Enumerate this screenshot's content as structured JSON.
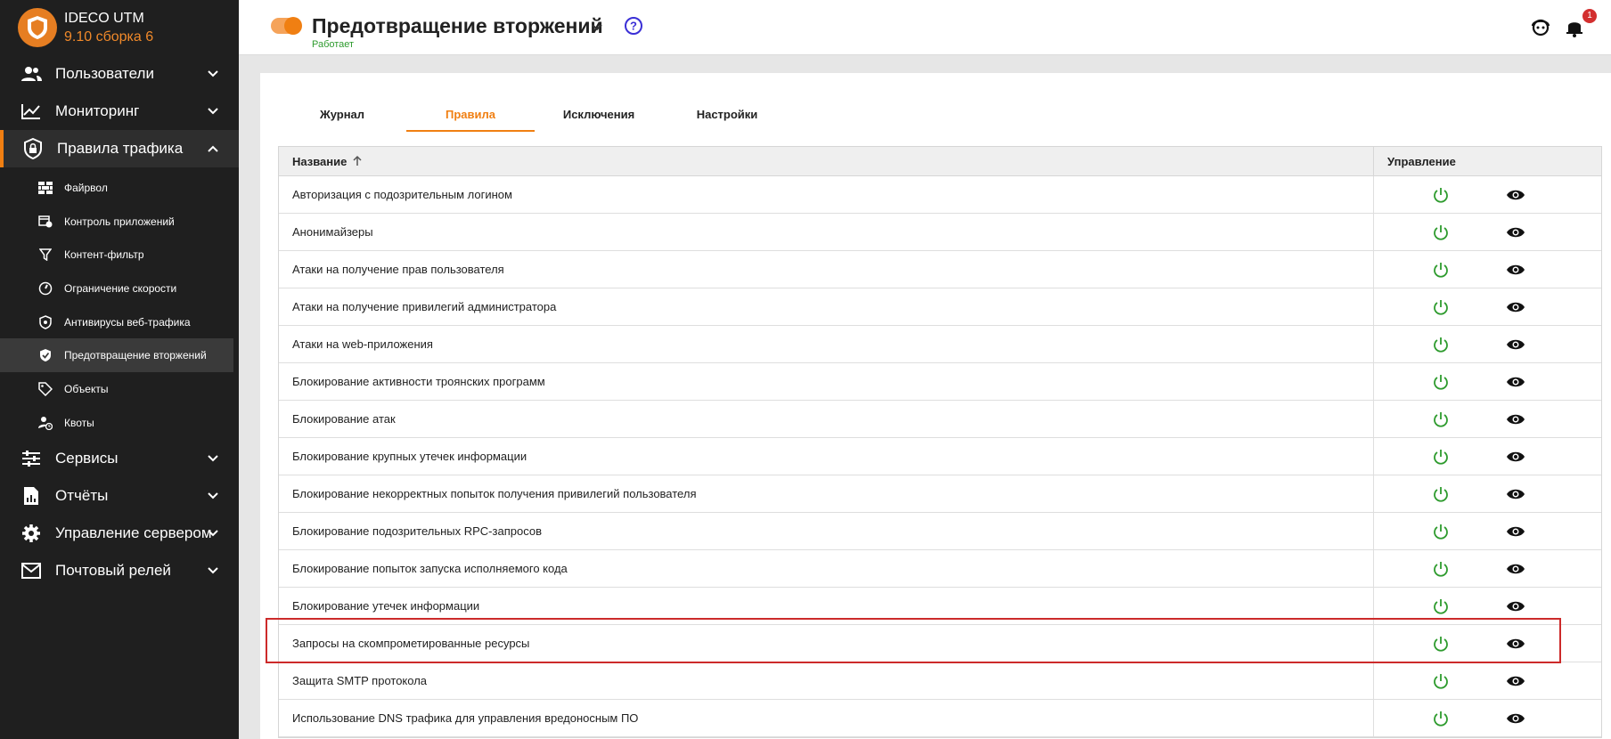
{
  "brand": {
    "name": "IDECO UTM",
    "version": "9.10 сборка 6"
  },
  "sidebar": {
    "top_items": [
      {
        "label": "Пользователи",
        "icon": "users-icon"
      },
      {
        "label": "Мониторинг",
        "icon": "chart-line-icon"
      }
    ],
    "active_item": {
      "label": "Правила трафика",
      "icon": "shield-lock-icon"
    },
    "sub_items": [
      {
        "label": "Файрвол",
        "icon": "brick-wall-icon"
      },
      {
        "label": "Контроль приложений",
        "icon": "app-control-icon"
      },
      {
        "label": "Контент-фильтр",
        "icon": "filter-icon"
      },
      {
        "label": "Ограничение скорости",
        "icon": "speedometer-icon"
      },
      {
        "label": "Антивирусы веб-трафика",
        "icon": "shield-icon"
      },
      {
        "label": "Предотвращение вторжений",
        "icon": "shield-check-icon"
      },
      {
        "label": "Объекты",
        "icon": "tag-icon"
      },
      {
        "label": "Квоты",
        "icon": "user-clock-icon"
      }
    ],
    "bottom_items": [
      {
        "label": "Сервисы",
        "icon": "sliders-icon"
      },
      {
        "label": "Отчёты",
        "icon": "report-icon"
      },
      {
        "label": "Управление сервером",
        "icon": "gear-icon"
      },
      {
        "label": "Почтовый релей",
        "icon": "mail-icon"
      }
    ]
  },
  "header": {
    "title": "Предотвращение вторжений",
    "status": "Работает",
    "notifications_count": "1"
  },
  "tabs": [
    "Журнал",
    "Правила",
    "Исключения",
    "Настройки"
  ],
  "active_tab": "Правила",
  "table": {
    "columns": {
      "name": "Название",
      "control": "Управление"
    },
    "rows": [
      "Авторизация с подозрительным логином",
      "Анонимайзеры",
      "Атаки на получение прав пользователя",
      "Атаки на получение привилегий администратора",
      "Атаки на web-приложения",
      "Блокирование активности троянских программ",
      "Блокирование атак",
      "Блокирование крупных утечек информации",
      "Блокирование некорректных попыток получения привилегий пользователя",
      "Блокирование подозрительных RPC-запросов",
      "Блокирование попыток запуска исполняемого кода",
      "Блокирование утечек информации",
      "Запросы на скомпрометированные ресурсы",
      "Защита SMTP протокола",
      "Использование DNS трафика для управления вредоносным ПО"
    ]
  },
  "colors": {
    "accent": "#f07f12",
    "sidebar_bg": "#1f1f1f",
    "status_ok": "#2e9b2e",
    "highlight": "#cc2a2a"
  }
}
